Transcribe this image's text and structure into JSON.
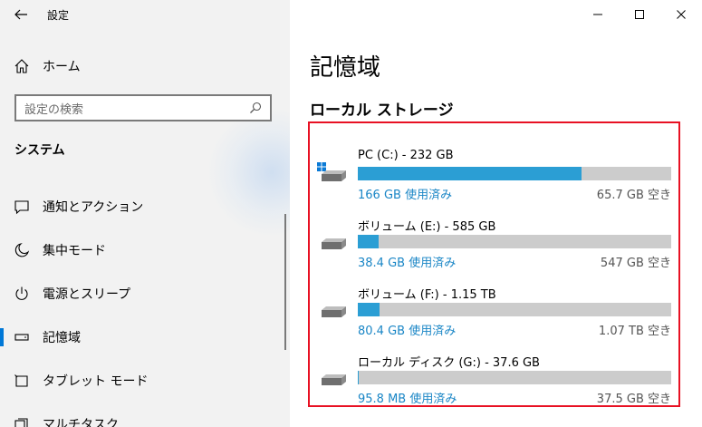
{
  "window": {
    "title": "設定",
    "controls": {
      "minimize_icon": "minimize-icon",
      "maximize_icon": "maximize-icon",
      "close_icon": "close-icon"
    }
  },
  "sidebar": {
    "home": {
      "label": "ホーム",
      "icon": "home-icon"
    },
    "search": {
      "placeholder": "設定の検索",
      "icon": "search-icon"
    },
    "section": "システム",
    "items": [
      {
        "label": "通知とアクション",
        "icon": "notification-icon",
        "active": false
      },
      {
        "label": "集中モード",
        "icon": "moon-icon",
        "active": false
      },
      {
        "label": "電源とスリープ",
        "icon": "power-icon",
        "active": false
      },
      {
        "label": "記憶域",
        "icon": "storage-icon",
        "active": true
      },
      {
        "label": "タブレット モード",
        "icon": "tablet-icon",
        "active": false
      },
      {
        "label": "マルチタスク",
        "icon": "multitasking-icon",
        "active": false
      }
    ]
  },
  "main": {
    "title": "記憶域",
    "subtitle": "ローカル ストレージ",
    "drives": [
      {
        "name": "PC (C:) - 232 GB",
        "used": "166 GB 使用済み",
        "free": "65.7 GB 空き",
        "used_fraction": 0.715,
        "icon": "windows-drive-icon"
      },
      {
        "name": "ボリューム (E:) - 585 GB",
        "used": "38.4 GB 使用済み",
        "free": "547 GB 空き",
        "used_fraction": 0.066,
        "icon": "drive-icon"
      },
      {
        "name": "ボリューム (F:) - 1.15 TB",
        "used": "80.4 GB 使用済み",
        "free": "1.07 TB 空き",
        "used_fraction": 0.068,
        "icon": "drive-icon"
      },
      {
        "name": "ローカル ディスク (G:) - 37.6 GB",
        "used": "95.8 MB 使用済み",
        "free": "37.5 GB 空き",
        "used_fraction": 0.0025,
        "icon": "drive-icon"
      }
    ]
  },
  "colors": {
    "accent": "#0078d7",
    "bar_fill": "#2b9ed4",
    "bar_track": "#cccccc",
    "highlight_border": "#e81123",
    "used_text": "#1a86c6"
  }
}
